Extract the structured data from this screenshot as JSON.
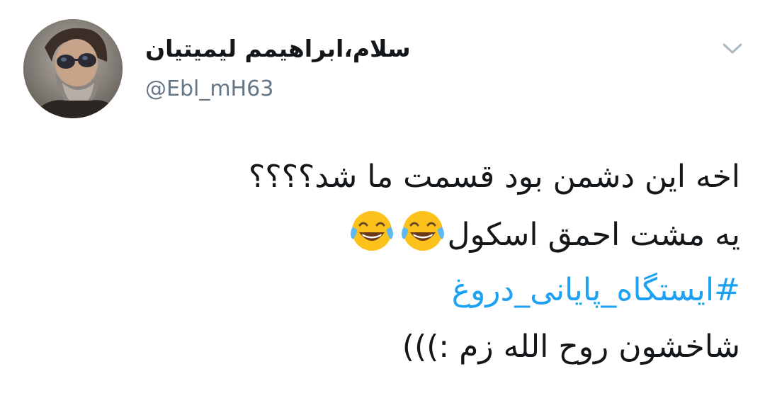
{
  "tweet": {
    "author": {
      "display_name": "سلام،ابراهیمم لیمیتیان",
      "handle": "@Ebl_mH63",
      "avatar_icon": "profile-photo"
    },
    "caret_icon": "chevron-down-icon",
    "lines": [
      "اخه این دشمن بود قسمت ما شد؟؟؟؟",
      "یه مشت احمق اسکول",
      "#ایستگاه_پایانی_دروغ",
      "شاخشون روح الله زم :)))"
    ],
    "emoji": [
      "face-with-tears-of-joy",
      "face-with-tears-of-joy"
    ],
    "colors": {
      "text": "#14171a",
      "handle": "#657786",
      "hashtag": "#1da1f2",
      "caret": "#aab8c2"
    }
  }
}
